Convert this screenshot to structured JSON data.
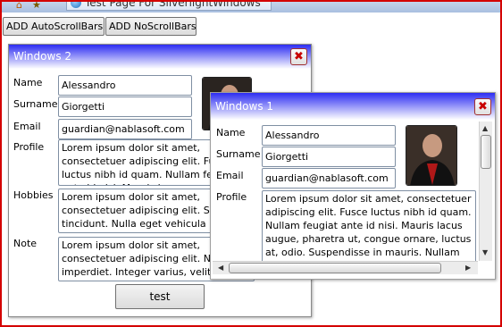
{
  "browser": {
    "tab_title": "Test Page For SilverlightWindows"
  },
  "toolbar": {
    "add_auto_label": "ADD AutoScrollBars",
    "add_no_label": "ADD NoScrollBars"
  },
  "window2": {
    "title": "Windows 2",
    "close_glyph": "✖",
    "name_label": "Name",
    "name_value": "Alessandro",
    "surname_label": "Surname",
    "surname_value": "Giorgetti",
    "email_label": "Email",
    "email_value": "guardian@nablasoft.com",
    "profile_label": "Profile",
    "profile_text": "Lorem ipsum dolor sit amet, consectetuer adipiscing elit. Fusce luctus nibh id quam. Nullam feugiat ante id nisi. Mauris lacus",
    "hobbies_label": "Hobbies",
    "hobbies_text": "Lorem ipsum dolor sit amet, consectetuer adipiscing elit. Sed tincidunt. Nulla eget vehicula lacus id libero. Morbi",
    "note_label": "Note",
    "note_text": "Lorem ipsum dolor sit amet, consectetuer adipiscing elit. Nulla imperdiet. Integer varius, velit risus luctus augue",
    "test_button_label": "test"
  },
  "window1": {
    "title": "Windows 1",
    "close_glyph": "✖",
    "name_label": "Name",
    "name_value": "Alessandro",
    "surname_label": "Surname",
    "surname_value": "Giorgetti",
    "email_label": "Email",
    "email_value": "guardian@nablasoft.com",
    "profile_label": "Profile",
    "profile_text": "Lorem ipsum dolor sit amet, consectetuer adipiscing elit. Fusce luctus nibh id quam. Nullam feugiat ante id nisi. Mauris lacus augue, pharetra ut, congue ornare, luctus at, odio. Suspendisse in mauris. Nullam"
  },
  "icons": {
    "up": "▲",
    "down": "▼",
    "left": "◀",
    "right": "▶"
  },
  "colors": {
    "title_gradient_start": "#2d2df2",
    "frame_border": "#d40000"
  }
}
